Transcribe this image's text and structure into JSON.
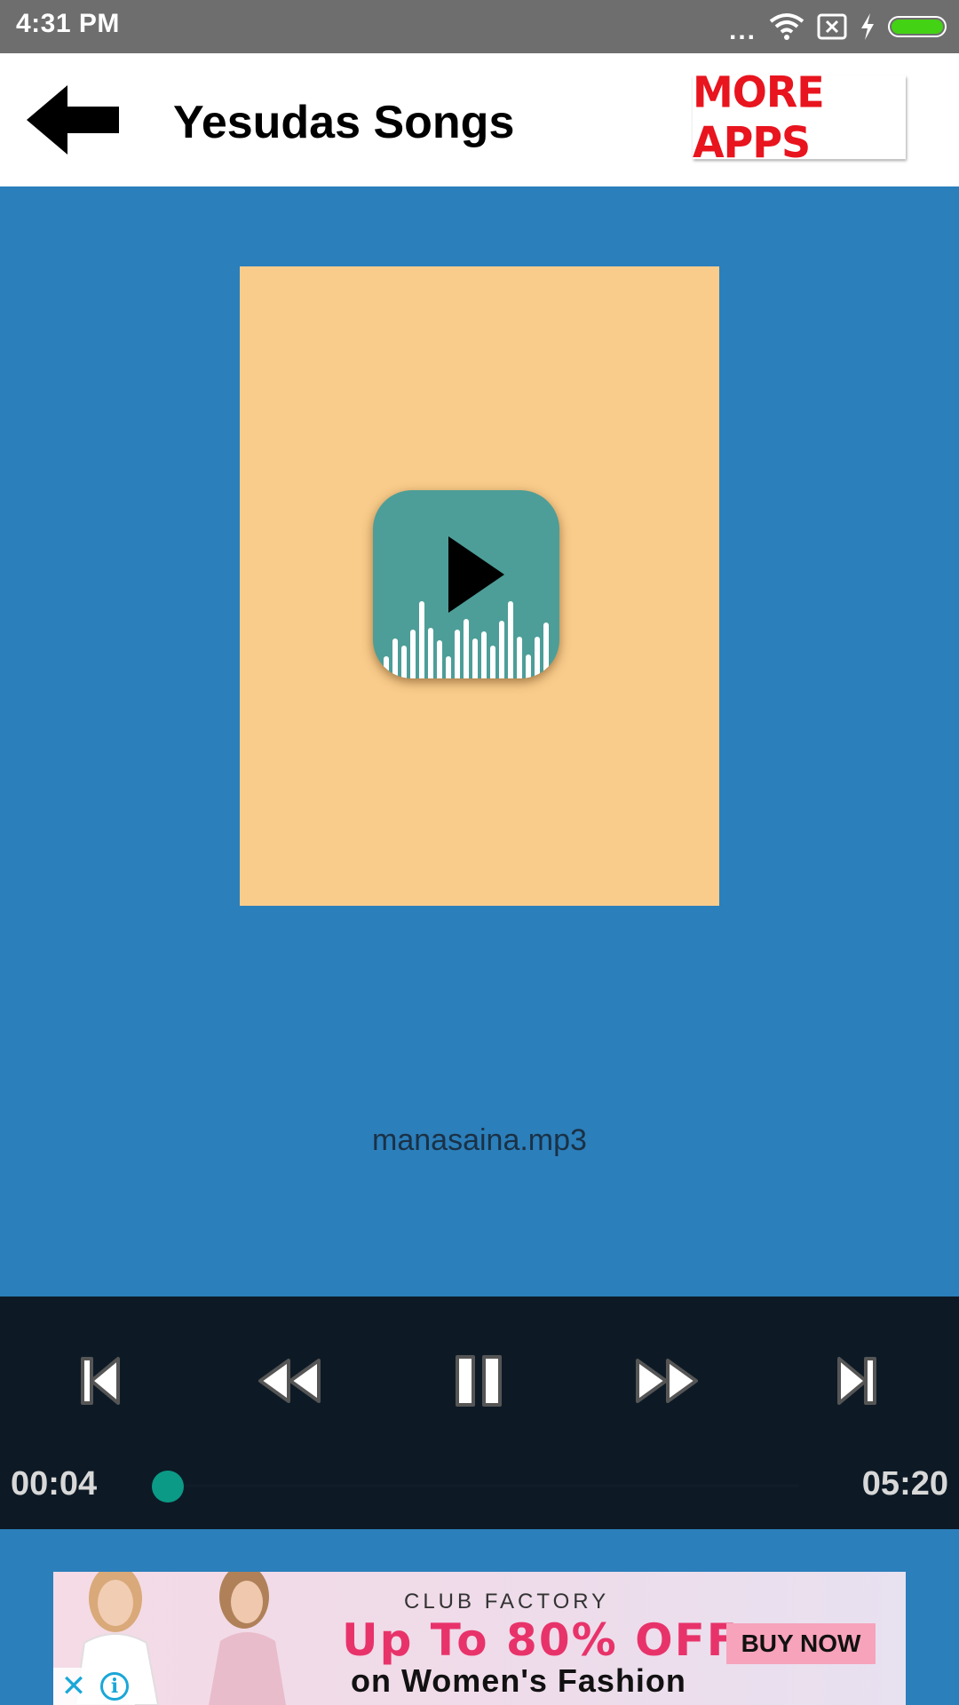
{
  "status_bar": {
    "time": "4:31 PM",
    "dots": "...",
    "battery_color": "#44d214"
  },
  "app_bar": {
    "title": "Yesudas Songs",
    "back_icon": "arrow-left-icon",
    "more_apps_label": "MORE APPS"
  },
  "album": {
    "background": "#f9cc8b",
    "icon": "play-equalizer-icon"
  },
  "track": {
    "name": "manasaina.mp3"
  },
  "player": {
    "current_time": "00:04",
    "total_time": "05:20",
    "progress": 0.0125,
    "controls": [
      "skip-previous-icon",
      "rewind-icon",
      "pause-icon",
      "fast-forward-icon",
      "skip-next-icon"
    ],
    "accent_color": "#0b9a85"
  },
  "ad": {
    "brand": "CLUB FACTORY",
    "headline": "Up To 80% OFF",
    "subline": "on Women's Fashion",
    "cta": "BUY NOW",
    "close_glyph": "✕",
    "info_glyph": "i"
  }
}
